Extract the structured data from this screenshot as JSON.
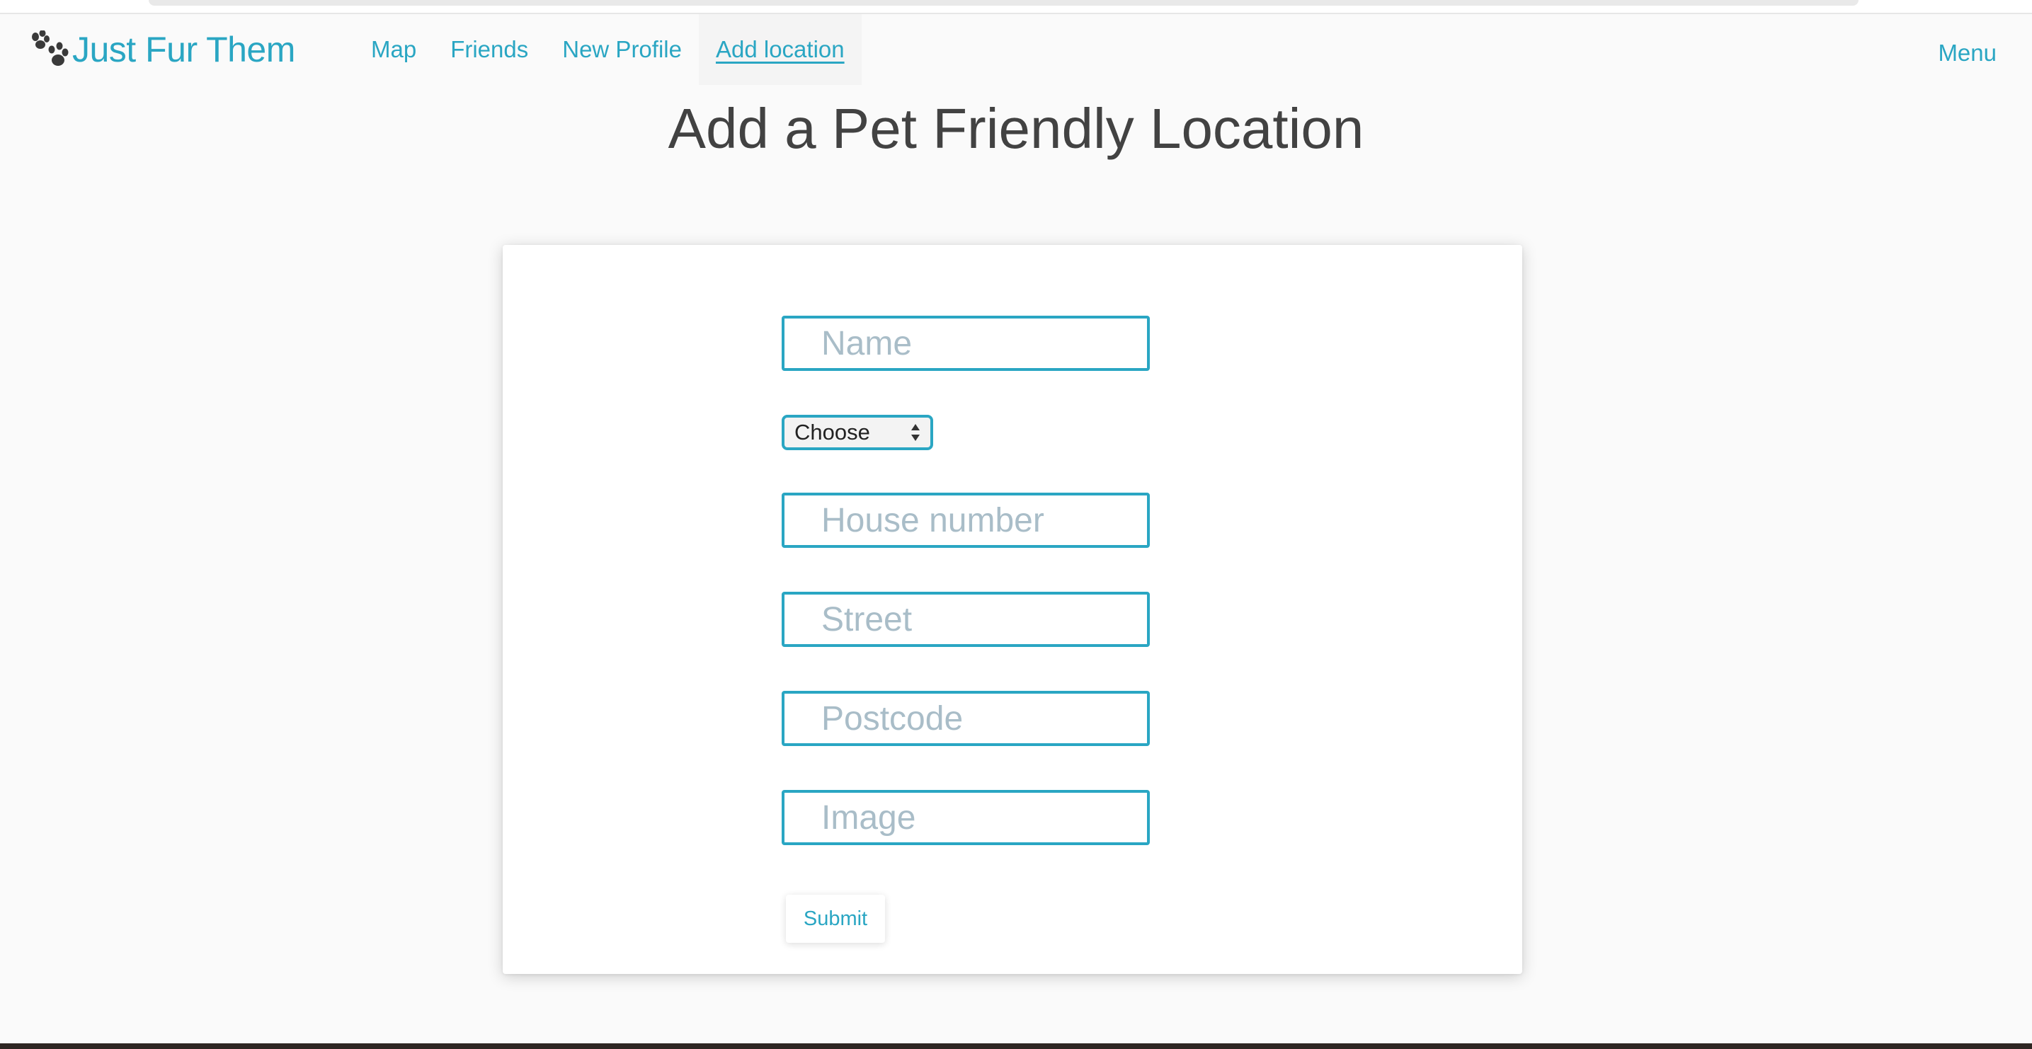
{
  "brand": {
    "name": "Just Fur Them",
    "icon": "paw-icon"
  },
  "nav": {
    "links": [
      {
        "label": "Map"
      },
      {
        "label": "Friends"
      },
      {
        "label": "New Profile"
      },
      {
        "label": "Add location",
        "active": true
      }
    ],
    "menu_label": "Menu"
  },
  "page": {
    "title": "Add a Pet Friendly Location"
  },
  "form": {
    "name_placeholder": "Name",
    "category_selected": "Choose",
    "house_number_placeholder": "House number",
    "street_placeholder": "Street",
    "postcode_placeholder": "Postcode",
    "image_placeholder": "Image",
    "submit_label": "Submit"
  },
  "colors": {
    "accent": "#2aa6c3",
    "title_text": "#424242",
    "placeholder": "#a9bdc8",
    "background": "#fafafa"
  }
}
